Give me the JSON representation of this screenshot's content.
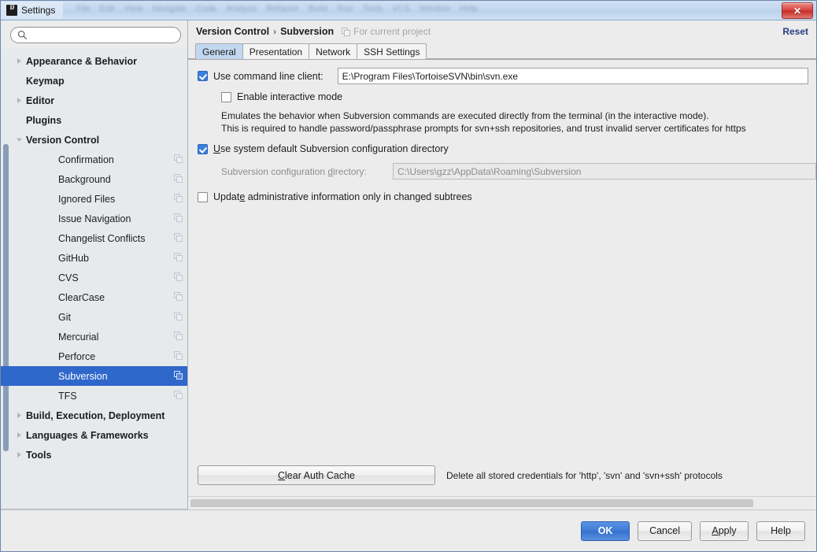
{
  "window": {
    "title": "Settings",
    "app_icon": "intellij-idea-icon",
    "close_label": "✕",
    "ghost_menu": [
      "File",
      "Edit",
      "View",
      "Navigate",
      "Code",
      "Analyze",
      "Refactor",
      "Build",
      "Run",
      "Tools",
      "VCS",
      "Window",
      "Help"
    ]
  },
  "sidebar": {
    "search": {
      "value": "",
      "placeholder": ""
    },
    "items": [
      {
        "label": "Appearance & Behavior",
        "type": "group",
        "arrow": "collapsed",
        "module": false,
        "selected": false
      },
      {
        "label": "Keymap",
        "type": "group",
        "arrow": "none",
        "module": false,
        "selected": false
      },
      {
        "label": "Editor",
        "type": "group",
        "arrow": "collapsed",
        "module": false,
        "selected": false
      },
      {
        "label": "Plugins",
        "type": "group",
        "arrow": "none",
        "module": false,
        "selected": false
      },
      {
        "label": "Version Control",
        "type": "group",
        "arrow": "expanded",
        "module": false,
        "selected": false
      },
      {
        "label": "Confirmation",
        "type": "child",
        "arrow": "none",
        "module": true,
        "selected": false
      },
      {
        "label": "Background",
        "type": "child",
        "arrow": "none",
        "module": true,
        "selected": false
      },
      {
        "label": "Ignored Files",
        "type": "child",
        "arrow": "none",
        "module": true,
        "selected": false
      },
      {
        "label": "Issue Navigation",
        "type": "child",
        "arrow": "none",
        "module": true,
        "selected": false
      },
      {
        "label": "Changelist Conflicts",
        "type": "child",
        "arrow": "none",
        "module": true,
        "selected": false
      },
      {
        "label": "GitHub",
        "type": "child",
        "arrow": "none",
        "module": true,
        "selected": false
      },
      {
        "label": "CVS",
        "type": "child",
        "arrow": "none",
        "module": true,
        "selected": false
      },
      {
        "label": "ClearCase",
        "type": "child",
        "arrow": "none",
        "module": true,
        "selected": false
      },
      {
        "label": "Git",
        "type": "child",
        "arrow": "none",
        "module": true,
        "selected": false
      },
      {
        "label": "Mercurial",
        "type": "child",
        "arrow": "none",
        "module": true,
        "selected": false
      },
      {
        "label": "Perforce",
        "type": "child",
        "arrow": "none",
        "module": true,
        "selected": false
      },
      {
        "label": "Subversion",
        "type": "child",
        "arrow": "none",
        "module": true,
        "selected": true
      },
      {
        "label": "TFS",
        "type": "child",
        "arrow": "none",
        "module": true,
        "selected": false
      },
      {
        "label": "Build, Execution, Deployment",
        "type": "group",
        "arrow": "collapsed",
        "module": false,
        "selected": false
      },
      {
        "label": "Languages & Frameworks",
        "type": "group",
        "arrow": "collapsed",
        "module": false,
        "selected": false
      },
      {
        "label": "Tools",
        "type": "group",
        "arrow": "collapsed",
        "module": false,
        "selected": false
      }
    ]
  },
  "main": {
    "breadcrumb": {
      "parent": "Version Control",
      "separator": "›",
      "current": "Subversion"
    },
    "scope": {
      "icon": "module-icon",
      "label": "For current project"
    },
    "reset_label": "Reset",
    "tabs": [
      {
        "label": "General",
        "active": true
      },
      {
        "label": "Presentation",
        "active": false
      },
      {
        "label": "Network",
        "active": false
      },
      {
        "label": "SSH Settings",
        "active": false
      }
    ],
    "use_command_line_client": {
      "checked": true,
      "label": "Use command line client:",
      "path_value": "E:\\Program Files\\TortoiseSVN\\bin\\svn.exe",
      "path_placeholder": ""
    },
    "enable_interactive_mode": {
      "checked": false,
      "label": "Enable interactive mode"
    },
    "interactive_desc_line1": "Emulates the behavior when Subversion commands are executed directly from the terminal (in the interactive mode).",
    "interactive_desc_line2": "This is required to handle password/passphrase prompts for svn+ssh repositories, and trust invalid server certificates for https",
    "use_system_default_dir": {
      "checked": true,
      "label_prefix": "",
      "label_mnemonic": "U",
      "label_suffix": "se system default Subversion configuration directory"
    },
    "config_dir": {
      "label_prefix": "Subversion configuration ",
      "label_mnemonic": "d",
      "label_suffix": "irectory:",
      "value": "C:\\Users\\gzz\\AppData\\Roaming\\Subversion",
      "disabled": true
    },
    "update_admin_info": {
      "checked": false,
      "label_prefix": "Updat",
      "label_mnemonic": "e",
      "label_suffix": " administrative information only in changed subtrees"
    },
    "clear_auth_cache": {
      "label_prefix": "",
      "label_mnemonic": "C",
      "label_suffix": "lear Auth Cache"
    },
    "clear_auth_note": "Delete all stored credentials for 'http', 'svn' and 'svn+ssh' protocols"
  },
  "footer": {
    "ok": "OK",
    "cancel": "Cancel",
    "apply_prefix": "",
    "apply_mnemonic": "A",
    "apply_suffix": "pply",
    "help": "Help"
  },
  "colors": {
    "selection_blue": "#2f68cb",
    "primary_button": "#3f7ad6",
    "checkbox_blue": "#3b7fe0",
    "tab_active": "#c2d7f0",
    "link_navy": "#2b3d7d"
  }
}
